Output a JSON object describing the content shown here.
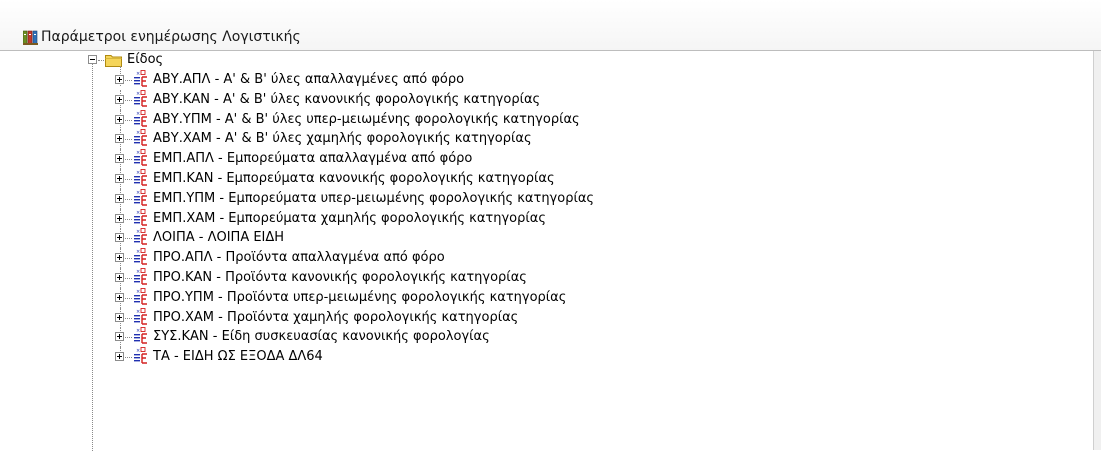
{
  "window": {
    "title": "Παράμετροι ενημέρωσης Λογιστικής",
    "title_icon": "ledger-books-icon"
  },
  "tree": {
    "root": {
      "label": "Είδος",
      "icon": "folder-open-icon",
      "expanded": true
    },
    "items": [
      "ΑΒΥ.ΑΠΛ - Α' & Β' ύλες απαλλαγμένες από φόρο",
      "ΑΒΥ.ΚΑΝ - Α' & Β' ύλες κανονικής φορολογικής κατηγορίας",
      "ΑΒΥ.ΥΠΜ - Α' & Β' ύλες υπερ-μειωμένης φορολογικής κατηγορίας",
      "ΑΒΥ.ΧΑΜ - Α' & Β' ύλες χαμηλής φορολογικής κατηγορίας",
      "ΕΜΠ.ΑΠΛ - Εμπορεύματα απαλλαγμένα από φόρο",
      "ΕΜΠ.ΚΑΝ - Εμπορεύματα κανονικής φορολογικής κατηγορίας",
      "ΕΜΠ.ΥΠΜ - Εμπορεύματα υπερ-μειωμένης φορολογικής κατηγορίας",
      "ΕΜΠ.ΧΑΜ - Εμπορεύματα χαμηλής φορολογικής κατηγορίας",
      "ΛΟΙΠΑ - ΛΟΙΠΑ ΕΙΔΗ",
      "ΠΡΟ.ΑΠΛ - Προϊόντα απαλλαγμένα από φόρο",
      "ΠΡΟ.ΚΑΝ - Προϊόντα κανονικής φορολογικής κατηγορίας",
      "ΠΡΟ.ΥΠΜ - Προϊόντα υπερ-μειωμένης φορολογικής κατηγορίας",
      "ΠΡΟ.ΧΑΜ - Προϊόντα χαμηλής φορολογικής κατηγορίας",
      "ΣΥΣ.ΚΑΝ - Είδη συσκευασίας κανονικής φορολογίας",
      "ΤΑ - ΕΙΔΗ ΩΣ ΕΞΟΔΑ ΔΛ64"
    ],
    "item_icon": "tax-category-icon",
    "expander_icon": "plus-expander-icon"
  },
  "colors": {
    "folder_fill": "#f5d55a",
    "folder_stroke": "#b08a10",
    "icon_red": "#d42020",
    "icon_blue": "#2030b0"
  }
}
